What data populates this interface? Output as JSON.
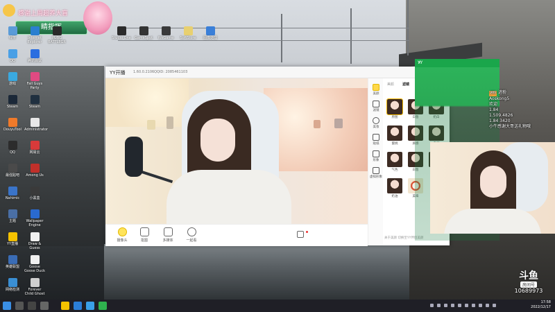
{
  "banner": {
    "thanks": "感谢上周超养大盲",
    "badge": "睛指挥"
  },
  "desktop_icons": [
    {
      "label": "绿茶",
      "color": "#5a9bd8"
    },
    {
      "label": "QQ",
      "color": "#4aa0e6"
    },
    {
      "label": "游戏",
      "color": "#3aa9e0"
    },
    {
      "label": "Steam",
      "color": "#1b2838"
    },
    {
      "label": "DouyuTool",
      "color": "#f07a2a"
    },
    {
      "label": "QQ",
      "color": "#2c2c2c"
    },
    {
      "label": "最强贴吧",
      "color": "#4a4a4a"
    },
    {
      "label": "Nahimic",
      "color": "#3a74c9"
    },
    {
      "label": "主题",
      "color": "#4a6fa5"
    },
    {
      "label": "YY直播",
      "color": "#f5c200"
    },
    {
      "label": "英雄联盟",
      "color": "#3a6cb5"
    },
    {
      "label": "网络检测",
      "color": "#3a8fd4"
    },
    {
      "label": "Internet Explorer",
      "color": "#2a7fd0"
    },
    {
      "label": "腾讯会议",
      "color": "#2a6ee0"
    },
    {
      "label": "Fall Guys Party",
      "color": "#e04a82"
    },
    {
      "label": "Steam",
      "color": "#203040"
    },
    {
      "label": "Administrator",
      "color": "#e8e8e8"
    },
    {
      "label": "网易云",
      "color": "#d93a3a"
    },
    {
      "label": "Among Us",
      "color": "#c0302a"
    },
    {
      "label": "小黑盒",
      "color": "#3a3a3a"
    },
    {
      "label": "Wallpaper Engine",
      "color": "#2a6ad0"
    },
    {
      "label": "Draw & Guess",
      "color": "#f0f0f0"
    },
    {
      "label": "Goose Goose Duck",
      "color": "#f0f0f0"
    },
    {
      "label": "Forever Child Ghost",
      "color": "#cfcfcf"
    },
    {
      "label": "PUBG BATTLEGR",
      "color": "#2a2a2a"
    }
  ],
  "top_icons": [
    {
      "label": "Studio One",
      "color": "#2b2b2b"
    },
    {
      "label": "GameSpot",
      "color": "#333"
    },
    {
      "label": "WeGame",
      "color": "#3a3a3a"
    },
    {
      "label": "SoftStore",
      "color": "#e8d070"
    },
    {
      "label": "图像处理",
      "color": "#3a7fd8"
    }
  ],
  "yy": {
    "title": "YY开播",
    "version": "1.60.0.2106",
    "qq_id": "QQID: 2085461103",
    "bottom_buttons": [
      "摄像头",
      "抠图",
      "多媒体",
      "一起看"
    ],
    "sidebar": [
      "美颜",
      "滤镜",
      "美妆",
      "贴纸",
      "形象",
      "虚拟形象"
    ],
    "tabs": [
      "美颜",
      "滤镜",
      "美妆"
    ],
    "filters": [
      "原图",
      "白皙",
      "奶白",
      "蜜桃",
      "质感",
      "自然",
      "气色",
      "白皙",
      "奶茶",
      "奶油",
      "美味"
    ],
    "footer": "关于美颜   切换至YY伴侣美颜"
  },
  "mini_window": {
    "title": "YY"
  },
  "chat": [
    {
      "badge": "进粉",
      "text": "进粉"
    },
    {
      "badge": "",
      "text": "Aoskong5"
    },
    {
      "badge": "",
      "text": "欢迎"
    },
    {
      "badge": "",
      "text": "1.84"
    },
    {
      "badge": "",
      "text": "1.509.4826"
    },
    {
      "badge": "",
      "text": "1.84 3420"
    },
    {
      "badge": "",
      "text": "小牛感谢大哥送礼物哦"
    }
  ],
  "watermark": {
    "logo": "斗鱼",
    "label": "房间号",
    "room": "10689973"
  },
  "taskbar": {
    "time": "17:58",
    "date": "2022/12/17"
  },
  "colors": {
    "accent": "#f3b700",
    "green": "#1aa64b",
    "taskbar": "#1f1f26"
  }
}
